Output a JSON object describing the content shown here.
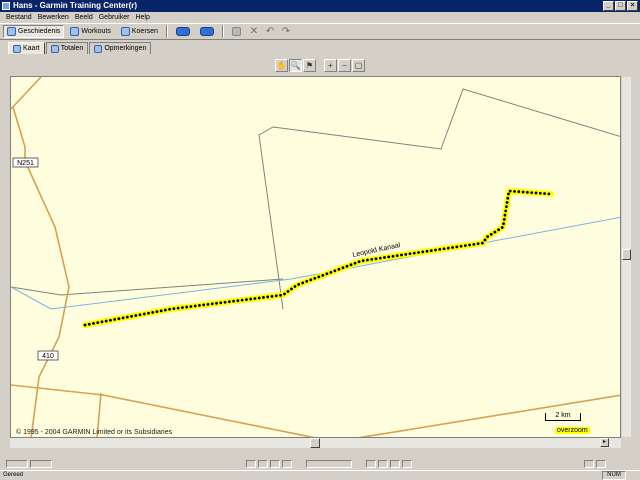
{
  "window": {
    "title": "Hans - Garmin Training Center(r)",
    "controls": [
      "_",
      "□",
      "×"
    ]
  },
  "menu": [
    "Bestand",
    "Bewerken",
    "Beeld",
    "Gebruiker",
    "Help"
  ],
  "toolbar": {
    "geschiedenis_label": "Geschiedenis",
    "workouts_label": "Workouts",
    "koersen_label": "Koersen",
    "delete_glyph": "✕",
    "undo_glyph": "↶",
    "redo_glyph": "↷"
  },
  "subtabs": [
    {
      "label": "Kaart",
      "icon": "map-icon",
      "active": true
    },
    {
      "label": "Totalen",
      "icon": "table-icon",
      "active": false
    },
    {
      "label": "Opmerkingen",
      "icon": "notes-icon",
      "active": false
    }
  ],
  "map_tools": {
    "pan": "✋",
    "select": "🔍",
    "flag": "⚑",
    "zoom_in": "+",
    "zoom_out": "−",
    "zoom_fit": "▢"
  },
  "map": {
    "road_labels": [
      "N251",
      "410"
    ],
    "canal_label": "Leopold Kanaal",
    "copyright": "© 1995 - 2004 GARMIN Limited or its Subsidiaries",
    "scale_label": "2 km",
    "overzoom_label": "overzoom",
    "colors": {
      "background": "#fefede",
      "road": "#d8a050",
      "border": "#808080",
      "water": "#80b0e0",
      "track_highlight": "#ffff00",
      "track_dots": "#000000"
    }
  },
  "statusbar": {
    "text": "Gereed",
    "num": "NUM"
  }
}
